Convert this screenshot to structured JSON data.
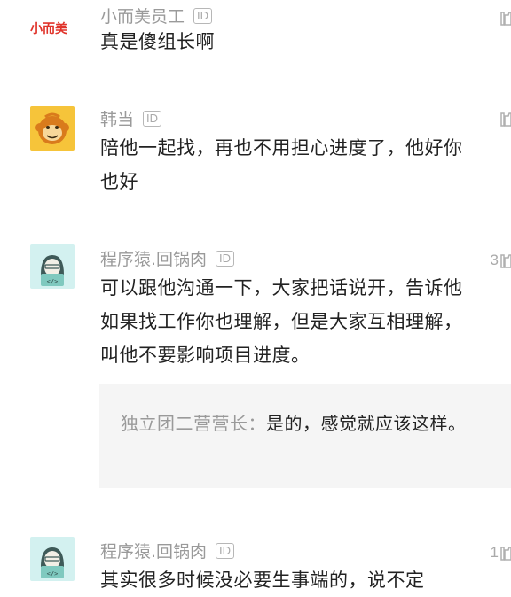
{
  "comments": [
    {
      "author": "小而美员工",
      "id_badge": "ID",
      "text": "真是傻组长啊",
      "likes": "",
      "avatar_logo": "小而美"
    },
    {
      "author": "韩当",
      "id_badge": "ID",
      "text": "陪他一起找，再也不用担心进度了，他好你也好",
      "likes": ""
    },
    {
      "author": "程序猿.回锅肉",
      "id_badge": "ID",
      "text": "可以跟他沟通一下，大家把话说开，告诉他如果找工作你也理解，但是大家互相理解，叫他不要影响项目进度。",
      "likes": "3",
      "reply": {
        "author": "独立团二营营长",
        "separator": "：",
        "text": "是的，感觉就应该这样。"
      }
    },
    {
      "author": "程序猿.回锅肉",
      "id_badge": "ID",
      "text": "其实很多时候没必要生事端的，说不定",
      "likes": "1"
    }
  ],
  "colors": {
    "brand_red": "#e0332a",
    "monkey_bg": "#f6c43a",
    "coder_bg": "#d3f1f0",
    "reply_bg": "#f5f5f5",
    "muted": "#9a9a9a"
  },
  "icons": {
    "like": "thumbs-up-icon",
    "coder_avatar": "programmer-avatar-icon",
    "monkey_avatar": "monkey-avatar-icon"
  }
}
